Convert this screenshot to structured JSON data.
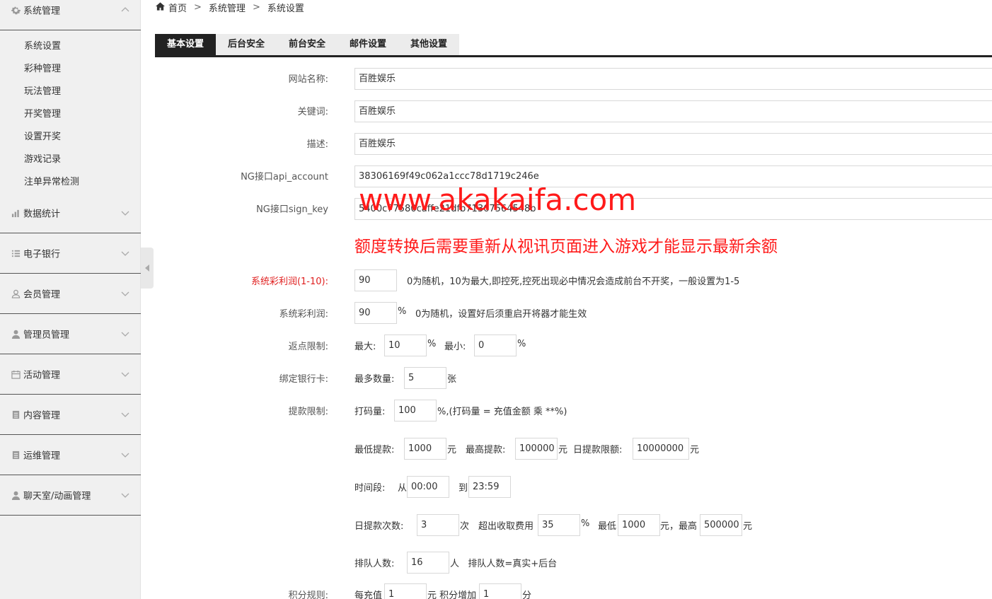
{
  "sidebar": {
    "top_group": {
      "label": "系统管理",
      "icon": "gear-icon"
    },
    "sub_items": [
      "系统设置",
      "彩种管理",
      "玩法管理",
      "开奖管理",
      "设置开奖",
      "游戏记录",
      "注单异常检测"
    ],
    "groups": [
      {
        "label": "数据统计",
        "icon": "bar-chart-icon"
      },
      {
        "label": "电子银行",
        "icon": "list-icon"
      },
      {
        "label": "会员管理",
        "icon": "user-outline-icon"
      },
      {
        "label": "管理员管理",
        "icon": "user-icon"
      },
      {
        "label": "活动管理",
        "icon": "calendar-icon"
      },
      {
        "label": "内容管理",
        "icon": "document-icon"
      },
      {
        "label": "运维管理",
        "icon": "document-icon"
      },
      {
        "label": "聊天室/动画管理",
        "icon": "user-icon"
      }
    ]
  },
  "breadcrumb": {
    "home": "首页",
    "sep": ">",
    "level1": "系统管理",
    "level2": "系统设置"
  },
  "tabs": [
    "基本设置",
    "后台安全",
    "前台安全",
    "邮件设置",
    "其他设置"
  ],
  "form": {
    "site_name_label": "网站名称:",
    "site_name": "百胜娱乐",
    "keywords_label": "关键词:",
    "keywords": "百胜娱乐",
    "description_label": "描述:",
    "description": "百胜娱乐",
    "api_account_label": "NG接口api_account",
    "api_account": "38306169f49c062a1ccc78d1719c246e",
    "sign_key_label": "NG接口sign_key",
    "sign_key": "5400c77580caffe21dfb71367564548b",
    "watermark": "www.akakaifa.com",
    "notice": "额度转换后需要重新从视讯页面进入游戏才能显示最新余额",
    "profit_110_label": "系统彩利润(1-10):",
    "profit_110": "90",
    "profit_110_hint": "0为随机，10为最大,即控死,控死出现必中情况会造成前台不开奖，一般设置为1-5",
    "profit_label": "系统彩利润:",
    "profit": "90",
    "profit_unit": "%",
    "profit_hint": "0为随机，设置好后须重启开将器才能生效",
    "rebate_label": "返点限制:",
    "rebate_max_label": "最大:",
    "rebate_max": "10",
    "rebate_pct1": "%",
    "rebate_min_label": "最小:",
    "rebate_min": "0",
    "rebate_pct2": "%",
    "bank_label": "绑定银行卡:",
    "bank_max_label": "最多数量:",
    "bank_max": "5",
    "bank_unit": "张",
    "withdraw_label": "提款限制:",
    "bet_label": "打码量:",
    "bet_value": "100",
    "bet_hint": "%,(打码量 = 充值金额 乘 **%)",
    "min_w_label": "最低提款:",
    "min_w": "1000",
    "yuan1": "元",
    "max_w_label": "最高提款:",
    "max_w": "100000",
    "yuan2": "元",
    "daily_limit_label": "日提款限额:",
    "daily_limit": "10000000",
    "yuan3": "元",
    "time_label": "时间段:",
    "time_from_label": "从",
    "time_from": "00:00",
    "time_to_label": "到",
    "time_to": "23:59",
    "daily_count_label": "日提款次数:",
    "daily_count": "3",
    "count_unit": "次",
    "fee_label": "超出收取费用",
    "fee": "35",
    "fee_pct": "%",
    "fee_min_label": "最低",
    "fee_min": "1000",
    "fee_max_label": "元，最高",
    "fee_max": "500000",
    "yuan4": "元",
    "queue_label": "排队人数:",
    "queue": "16",
    "queue_hint": "人   排队人数=真实+后台",
    "points_label": "积分规则:",
    "points_each_label": "每充值",
    "points_each": "1",
    "points_mid": "元 积分增加",
    "points_add": "1",
    "points_unit": "分"
  }
}
